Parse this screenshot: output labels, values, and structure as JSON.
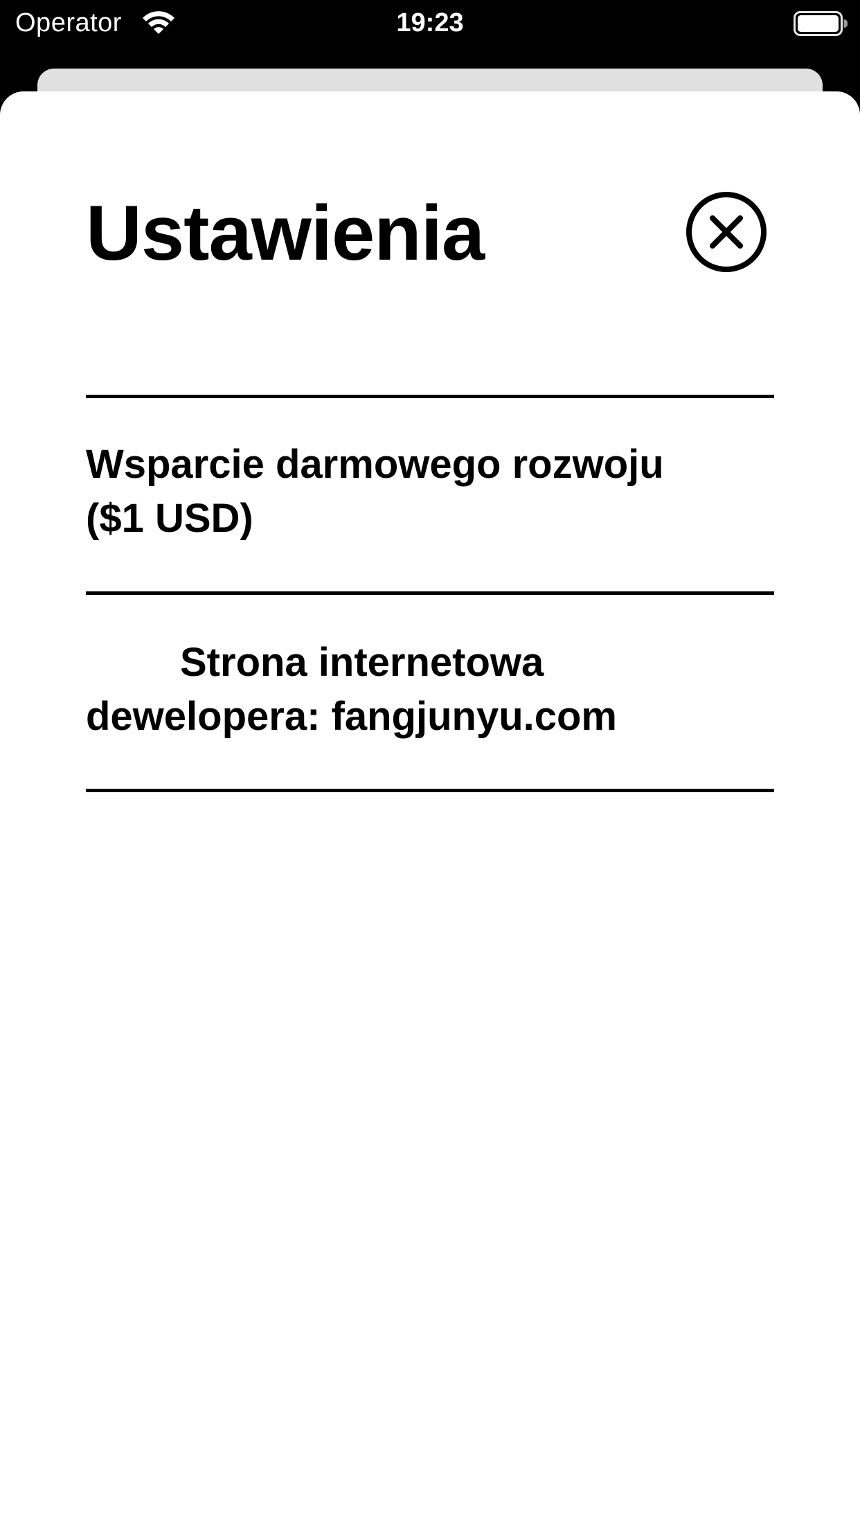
{
  "status_bar": {
    "carrier": "Operator",
    "time": "19:23",
    "wifi_icon": "wifi-icon",
    "battery_icon": "battery-full-icon"
  },
  "settings": {
    "title": "Ustawienia",
    "close_icon": "close-circle-icon",
    "items": [
      {
        "label_line1": "Wsparcie darmowego rozwoju",
        "label_line2": "($1 USD)"
      },
      {
        "label_line1": "Strona internetowa",
        "label_line2": "dewelopera: fangjunyu.com"
      }
    ]
  },
  "colors": {
    "status_bar_bg": "#000000",
    "sheet_bg": "#ffffff",
    "back_card_bg": "#e0e0e0",
    "text": "#000000"
  }
}
